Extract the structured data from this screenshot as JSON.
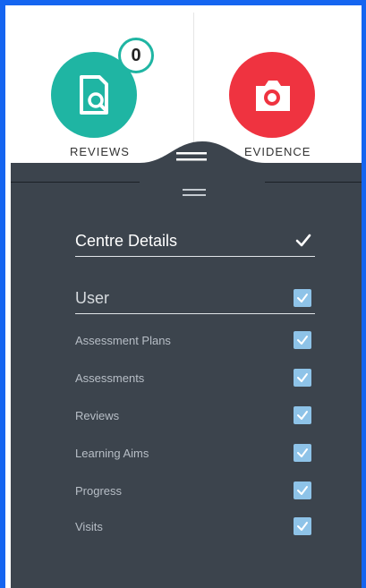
{
  "tabs": {
    "reviews": {
      "label": "REVIEWS",
      "badge": "0",
      "icon": "document-search-icon",
      "color": "#1fb5a3"
    },
    "evidence": {
      "label": "EVIDENCE",
      "icon": "camera-icon",
      "color": "#ef3340"
    }
  },
  "menu": {
    "centre_details": {
      "label": "Centre Details",
      "checked": true
    },
    "user": {
      "label": "User",
      "checked": true
    },
    "items": [
      {
        "label": "Assessment Plans",
        "checked": true
      },
      {
        "label": "Assessments",
        "checked": true
      },
      {
        "label": "Reviews",
        "checked": true
      },
      {
        "label": "Learning Aims",
        "checked": true
      },
      {
        "label": "Progress",
        "checked": true
      },
      {
        "label": "Visits",
        "checked": true
      }
    ]
  },
  "colors": {
    "frame": "#1565f0",
    "panel": "#3c444d",
    "checkbox": "#8ec3e8"
  }
}
